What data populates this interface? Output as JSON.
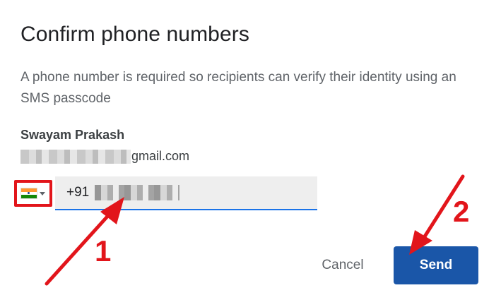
{
  "dialog": {
    "title": "Confirm phone numbers",
    "description": "A phone number is required so recipients can verify their identity using an SMS passcode"
  },
  "recipient": {
    "name": "Swayam Prakash",
    "email_suffix": "gmail.com"
  },
  "phone": {
    "country_icon": "india-flag-icon",
    "prefix": "+91"
  },
  "actions": {
    "cancel_label": "Cancel",
    "send_label": "Send"
  },
  "annotations": {
    "step1": "1",
    "step2": "2",
    "color": "#e2151b"
  },
  "colors": {
    "send_button": "#1a56a8",
    "input_underline": "#1a73e8",
    "input_background": "#eeeeee"
  }
}
